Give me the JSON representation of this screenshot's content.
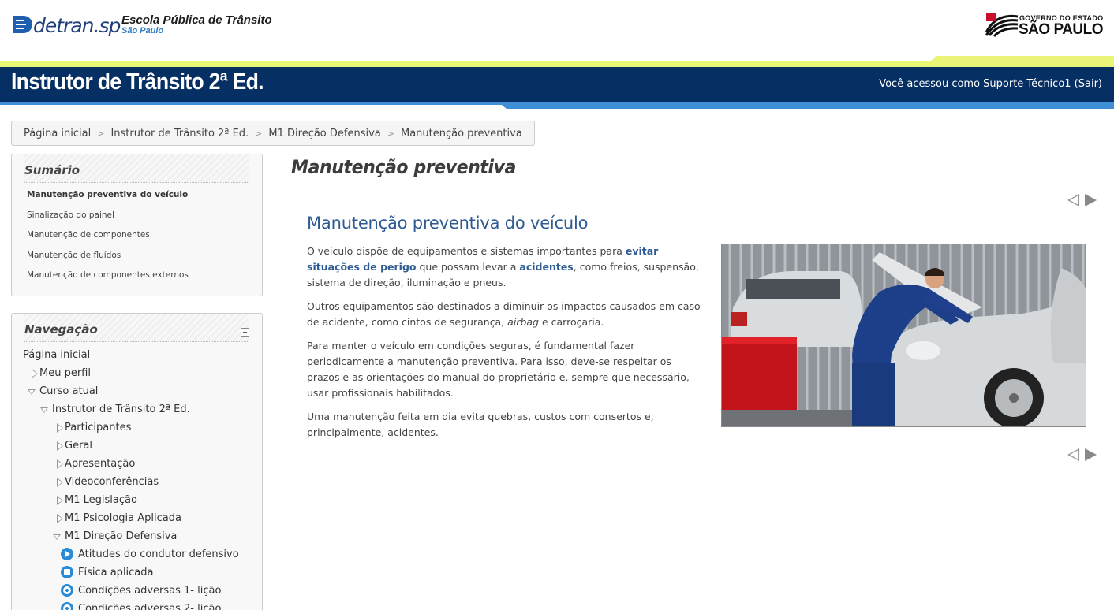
{
  "header": {
    "detran_logo_text": "detran",
    "detran_logo_suffix": ".sp",
    "escola_line1": "Escola Pública de Trânsito",
    "escola_line2": "São Paulo",
    "gov_line1": "GOVERNO DO ESTADO",
    "gov_line2": "SÃO PAULO",
    "course_title": "Instrutor de Trânsito 2ª Ed.",
    "login_info": "Você acessou como Suporte Técnico1 (Sair)"
  },
  "breadcrumb": [
    "Página inicial",
    "Instrutor de Trânsito 2ª Ed.",
    "M1 Direção Defensiva",
    "Manutenção preventiva"
  ],
  "breadcrumb_separator": ">",
  "summary": {
    "title": "Sumário",
    "items": [
      "Manutenção preventiva do veículo",
      "Sinalização do painel",
      "Manutenção de componentes",
      "Manutenção de fluídos",
      "Manutenção de componentes externos"
    ]
  },
  "navigation": {
    "title": "Navegação",
    "items": [
      "Página inicial",
      "Meu perfil",
      "Curso atual",
      "Instrutor de Trânsito 2ª Ed.",
      "Participantes",
      "Geral",
      "Apresentação",
      "Videoconferências",
      "M1 Legislação",
      "M1 Psicologia Aplicada",
      "M1 Direção Defensiva",
      "Atitudes do condutor defensivo",
      "Física aplicada",
      "Condições adversas 1- lição",
      "Condições adversas 2- lição"
    ]
  },
  "main": {
    "page_title": "Manutenção preventiva",
    "heading": "Manutenção preventiva do veículo",
    "p1_a": "O veículo dispõe de equipamentos e sistemas importantes para ",
    "p1_hl1": "evitar situações de perigo",
    "p1_b": " que possam levar a ",
    "p1_hl2": "acidentes",
    "p1_c": ", como freios, suspensão, sistema de direção, iluminação e pneus.",
    "p2_a": "Outros equipamentos são destinados a diminuir os impactos causados em caso de acidente, como cintos de segurança, ",
    "p2_em": "airbag",
    "p2_b": " e carroçaria.",
    "p3": "Para manter o veículo em condições seguras, é fundamental fazer periodicamente a manutenção preventiva. Para isso, deve-se respeitar os prazos e as orientações do manual do proprietário e, sempre que necessário, usar profissionais habilitados.",
    "p4": "Uma manutenção feita em dia evita quebras, custos com consertos e, principalmente, acidentes."
  },
  "colors": {
    "band": "#062f63",
    "accent_green": "#eaf578",
    "accent_blue": "#3f8fd6",
    "link_blue": "#2e5b94"
  }
}
